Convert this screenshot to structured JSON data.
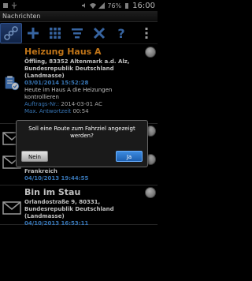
{
  "statusbar": {
    "battery": "76%",
    "time": "16:00"
  },
  "window": {
    "title": "Nachrichten"
  },
  "toolbar": {
    "icons": [
      "connection-icon",
      "plus-icon",
      "grid-icon",
      "filter-list-icon",
      "close-x-icon",
      "help-icon",
      "overflow-menu-icon"
    ],
    "help_glyph": "?"
  },
  "messages": [
    {
      "title": "Heizung Haus A",
      "address": "Öffling, 83352 Altenmark a.d. Alz, Bundesrepublik Deutschland (Landmasse)",
      "date": "03/01/2014 15:52:28",
      "text": "Heute im Haus A die Heizungen kontrollieren",
      "order_label": "Auftrags-Nr.:",
      "order_value": "2014-03-01 AC",
      "response_label": "Max. Antwortzeit",
      "response_value": "00:54"
    },
    {
      "title_partial": "Frankreich",
      "date": "04/10/2013 19:44:55"
    },
    {
      "title": "Bin im Stau",
      "address": "Orlandostraße 9,  80331, Bundesrepublik Deutschland (Landmasse)",
      "date": "04/10/2013 16:53:11"
    }
  ],
  "dialog": {
    "message": "Soll eine Route zum Fahrziel angezeigt werden?",
    "no_label": "Nein",
    "yes_label": "Ja"
  },
  "colors": {
    "accent_orange": "#ff9b21",
    "accent_blue": "#4a9cf0",
    "toolbar_blue": "#3c6ab8"
  }
}
